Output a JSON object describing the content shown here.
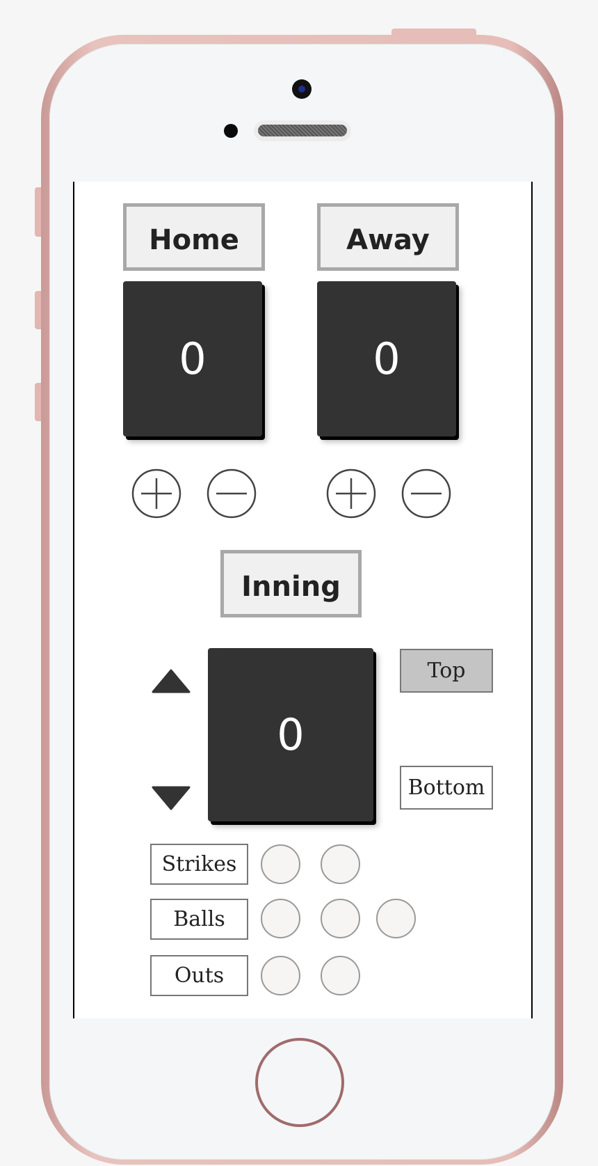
{
  "device": {
    "frame_color": "#e6bdb8"
  },
  "teams": [
    {
      "label": "Home",
      "score": "0"
    },
    {
      "label": "Away",
      "score": "0"
    }
  ],
  "controls": {
    "increment_icon": "plus-circle-icon",
    "decrement_icon": "minus-circle-icon"
  },
  "inning": {
    "label": "Inning",
    "value": "0",
    "up_icon": "triangle-up-icon",
    "down_icon": "triangle-down-icon",
    "top_label": "Top",
    "bottom_label": "Bottom",
    "selected_half": "Top"
  },
  "counts": [
    {
      "label": "Strikes",
      "slots": 2,
      "filled": 0
    },
    {
      "label": "Balls",
      "slots": 3,
      "filled": 0
    },
    {
      "label": "Outs",
      "slots": 2,
      "filled": 0
    }
  ],
  "colors": {
    "score_bg": "#333333",
    "selected_half_bg": "#c4c4c4"
  }
}
